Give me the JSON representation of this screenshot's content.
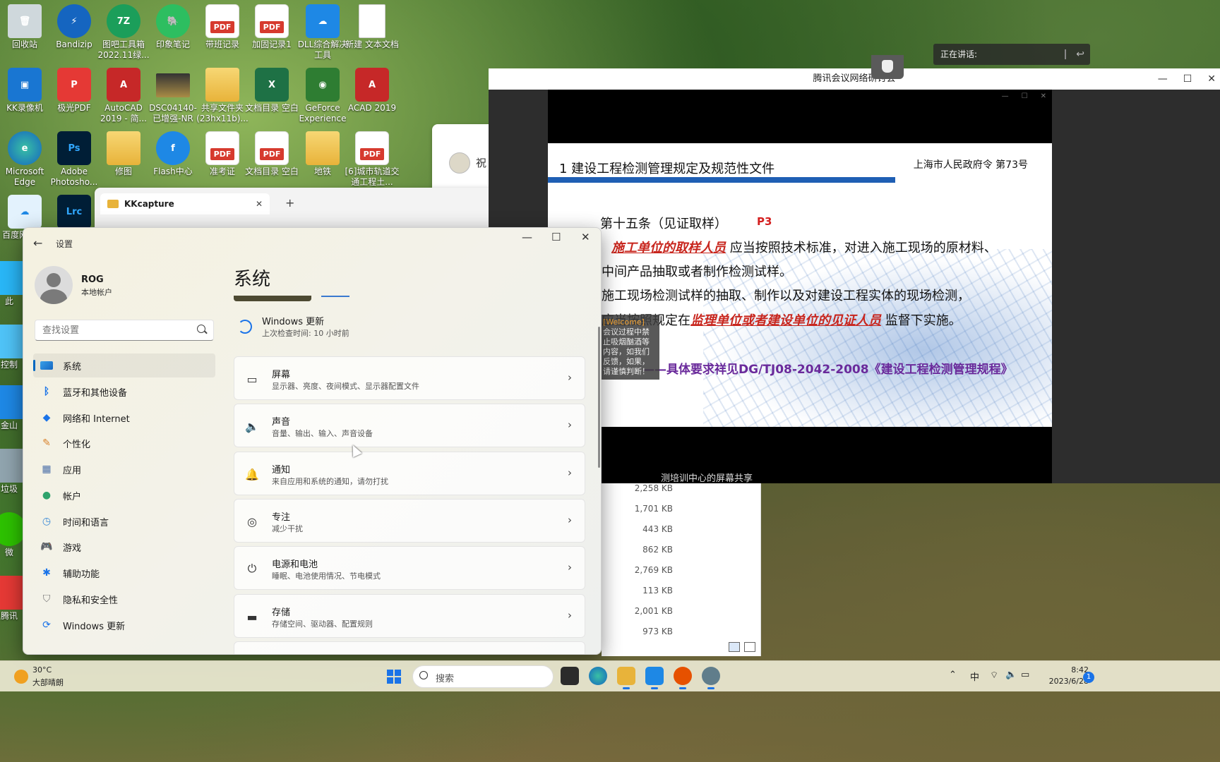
{
  "desktop": {
    "icons": [
      {
        "label": "回收站"
      },
      {
        "label": "Bandizip"
      },
      {
        "label": "图吧工具箱 2022.11绿..."
      },
      {
        "label": "印象笔记"
      },
      {
        "label": "带班记录"
      },
      {
        "label": "加固记录1"
      },
      {
        "label": "DLL综合解决工具"
      },
      {
        "label": "新建 文本文档"
      },
      {
        "label": "KK录像机"
      },
      {
        "label": "极光PDF"
      },
      {
        "label": "AutoCAD 2019 - 简..."
      },
      {
        "label": "DSC04140-已增强-NR"
      },
      {
        "label": "共享文件夹 (23hx11b)..."
      },
      {
        "label": "文档目录 空白"
      },
      {
        "label": "GeForce Experience"
      },
      {
        "label": "ACAD 2019"
      },
      {
        "label": "Microsoft Edge"
      },
      {
        "label": "Adobe Photosho..."
      },
      {
        "label": "修图"
      },
      {
        "label": "Flash中心"
      },
      {
        "label": "准考证"
      },
      {
        "label": "文档目录 空白"
      },
      {
        "label": "地铁"
      },
      {
        "label": "[6]城市轨道交通工程土..."
      },
      {
        "label": "百度网盘 捷"
      },
      {
        "label": "Lrc"
      },
      {
        "label": "此"
      },
      {
        "label": "控制"
      },
      {
        "label": "金山"
      },
      {
        "label": "垃圾"
      },
      {
        "label": "微"
      },
      {
        "label": "腾讯"
      }
    ]
  },
  "explorer": {
    "tab_title": "KKcapture",
    "tab_close": "✕",
    "new_tab": "+",
    "sizes": [
      "2,258 KB",
      "1,701 KB",
      "443 KB",
      "862 KB",
      "2,769 KB",
      "113 KB",
      "2,001 KB",
      "973 KB"
    ]
  },
  "greeting": {
    "text": "祝"
  },
  "meeting": {
    "title": "腾讯会议网络研讨会",
    "min": "—",
    "max": "☐",
    "close": "✕",
    "speaking_label": "正在讲话:",
    "share_caption": "测培训中心的屏幕共享",
    "slide": {
      "heading": "1  建设工程检测管理规定及规范性文件",
      "source": "上海市人民政府令    第73号",
      "article": "第十五条（见证取样）",
      "page_tag": "P3",
      "line1_hl": "施工单位的取样人员",
      "line1_rest": " 应当按照技术标准，对进入施工现场的原材料、",
      "line2": "中间产品抽取或者制作检测试样。",
      "line3": "     施工现场检测试样的抽取、制作以及对建设工程实体的现场检测，",
      "line4_pre": "应当按照规定在",
      "line4_hl": "监理单位或者建设单位的见证人员",
      "line4_post": " 监督下实施。",
      "reference": "——具体要求祥见DG/TJ08-2042-2008《建设工程检测管理规程》"
    },
    "chat": {
      "who": "[Welcome]",
      "text": "会议过程中禁止吸烟酗酒等内容，如我们反馈，如果，请谨慎判断！"
    }
  },
  "settings": {
    "app_title": "设置",
    "back": "←",
    "min": "—",
    "max": "☐",
    "close": "✕",
    "user": {
      "name": "ROG",
      "account_type": "本地帐户"
    },
    "search": {
      "placeholder": "查找设置"
    },
    "nav": [
      {
        "label": "系统",
        "icon": "system-icon",
        "active": true
      },
      {
        "label": "蓝牙和其他设备",
        "icon": "bluetooth-icon"
      },
      {
        "label": "网络和 Internet",
        "icon": "network-icon"
      },
      {
        "label": "个性化",
        "icon": "brush-icon"
      },
      {
        "label": "应用",
        "icon": "apps-icon"
      },
      {
        "label": "帐户",
        "icon": "account-icon"
      },
      {
        "label": "时间和语言",
        "icon": "time-language-icon"
      },
      {
        "label": "游戏",
        "icon": "gaming-icon"
      },
      {
        "label": "辅助功能",
        "icon": "accessibility-icon"
      },
      {
        "label": "隐私和安全性",
        "icon": "shield-icon"
      },
      {
        "label": "Windows 更新",
        "icon": "windows-update-icon"
      }
    ],
    "page_title": "系统",
    "update_banner": {
      "title": "Windows 更新",
      "subtitle": "上次检查时间: 10 小时前"
    },
    "cards": [
      {
        "title": "屏幕",
        "subtitle": "显示器、亮度、夜间模式、显示器配置文件",
        "icon": "display-icon"
      },
      {
        "title": "声音",
        "subtitle": "音量、输出、输入、声音设备",
        "icon": "speaker-icon"
      },
      {
        "title": "通知",
        "subtitle": "来自应用和系统的通知，请勿打扰",
        "icon": "bell-icon"
      },
      {
        "title": "专注",
        "subtitle": "减少干扰",
        "icon": "focus-icon"
      },
      {
        "title": "电源和电池",
        "subtitle": "睡眠、电池使用情况、节电模式",
        "icon": "power-icon"
      },
      {
        "title": "存储",
        "subtitle": "存储空间、驱动器、配置规则",
        "icon": "storage-icon"
      }
    ]
  },
  "taskbar": {
    "weather": {
      "temp": "30°C",
      "condition": "大部晴朗"
    },
    "search_placeholder": "搜索",
    "ime": "中",
    "time": "8:42",
    "date": "2023/6/28",
    "notifications": "1",
    "accent": "#1a73e8"
  }
}
